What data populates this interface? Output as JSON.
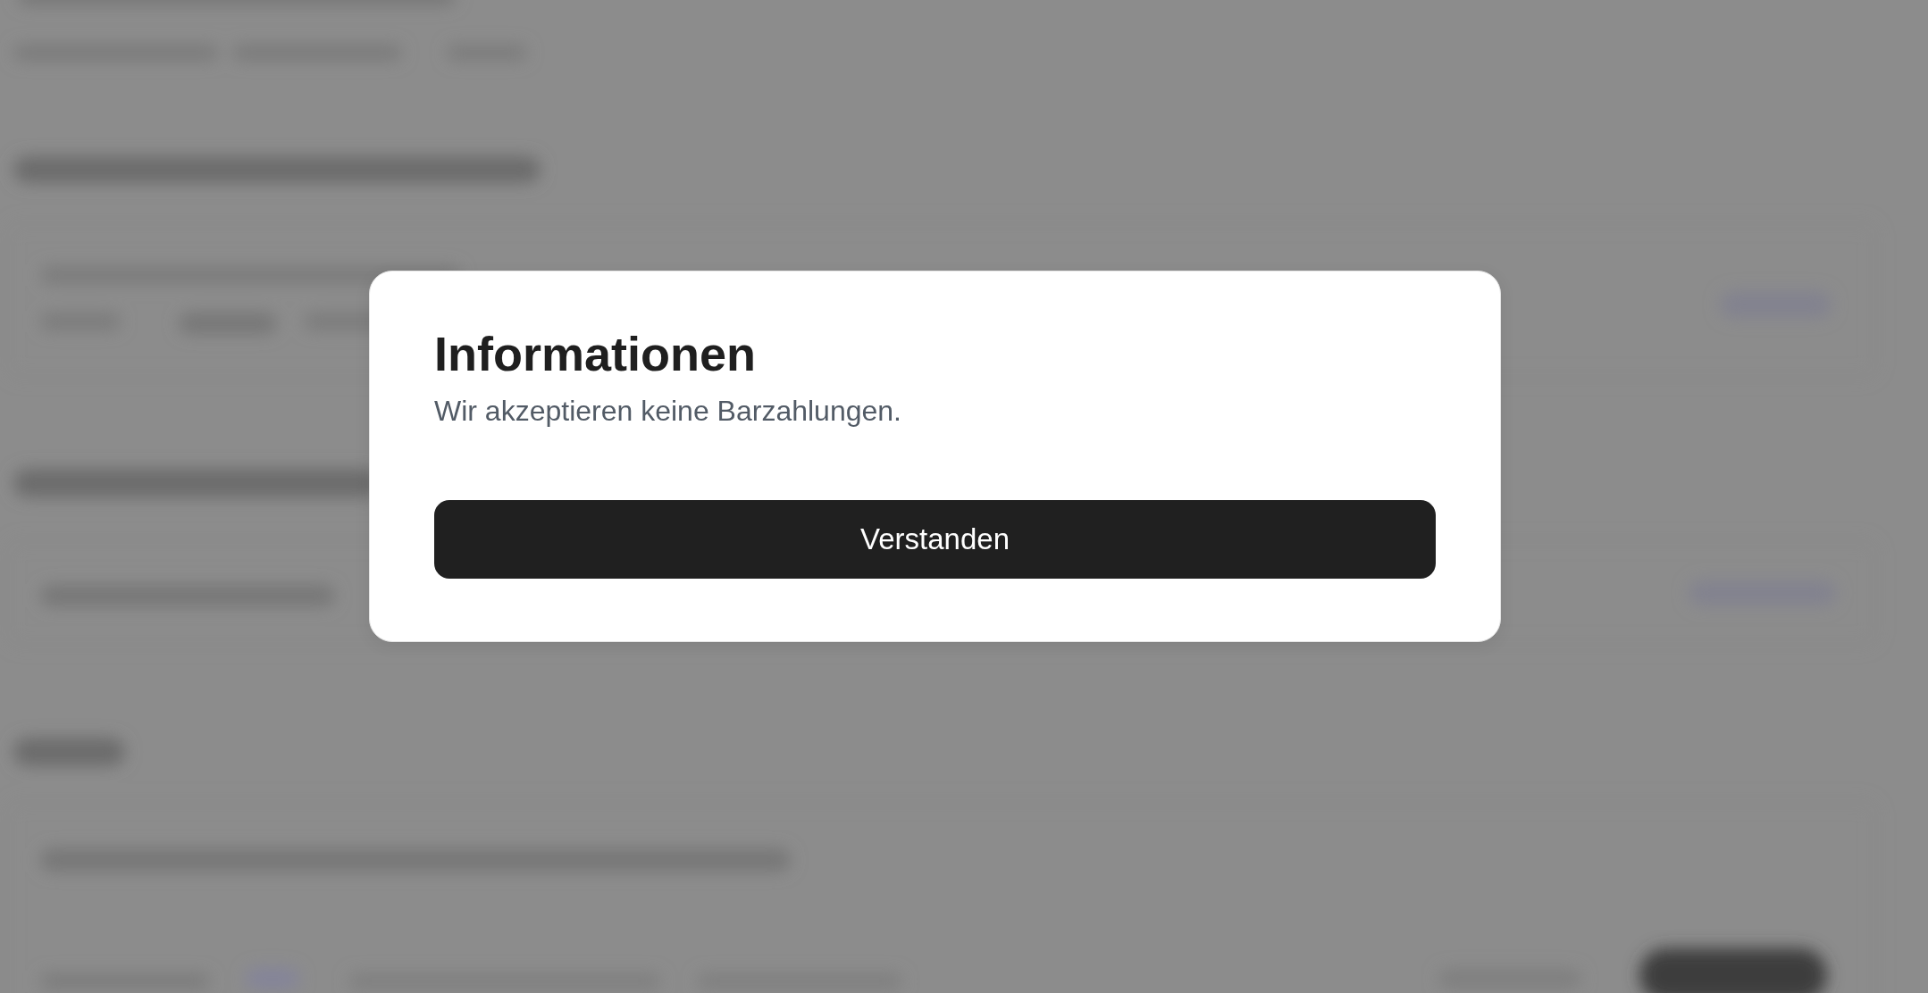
{
  "dialog": {
    "title": "Informationen",
    "message": "Wir akzeptieren keine Barzahlungen.",
    "button": "Verstanden"
  }
}
